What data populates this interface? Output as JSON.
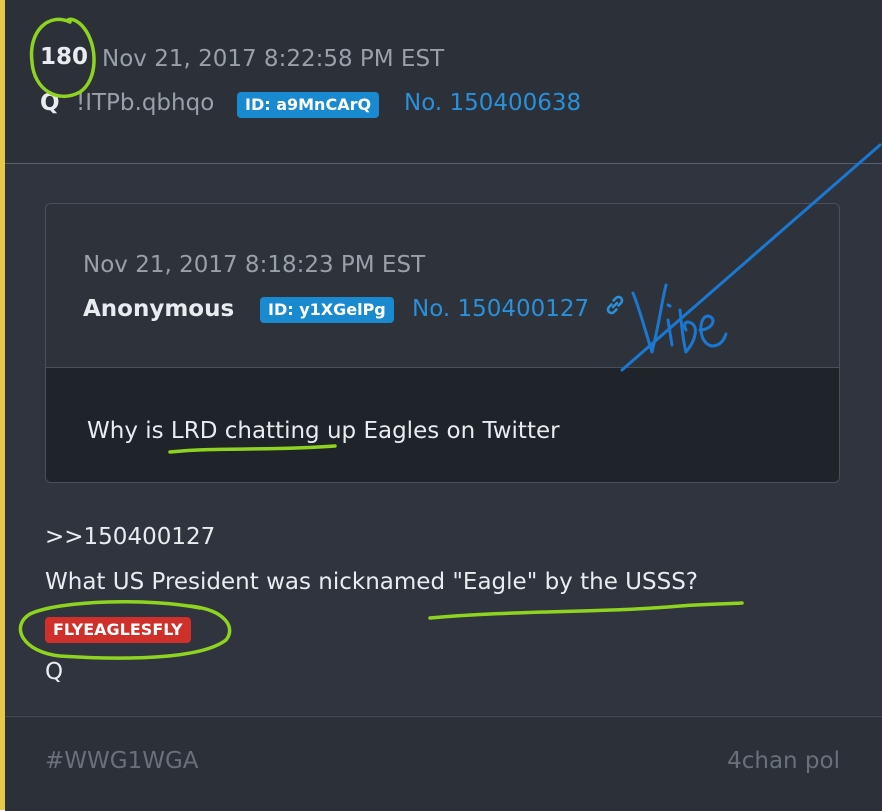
{
  "post": {
    "number": "180",
    "date": "Nov 21, 2017 8:22:58 PM EST",
    "author": "Q",
    "tripcode": "!ITPb.qbhqo",
    "id_badge": "ID: a9MnCArQ",
    "post_no": "No. 150400638"
  },
  "quoted": {
    "date": "Nov 21, 2017 8:18:23 PM EST",
    "author": "Anonymous",
    "id_badge": "ID: y1XGelPg",
    "post_no": "No. 150400127",
    "text": "Why is LRD chatting up Eagles on Twitter"
  },
  "reply": {
    "link": ">>150400127",
    "message": "What US President was nicknamed \"Eagle\" by the USSS?",
    "flag_badge": "FLYEAGLESFLY",
    "signature": "Q"
  },
  "footer": {
    "hashtag": "#WWG1WGA",
    "source": "4chan pol"
  },
  "annotation": {
    "handwriting": "Vibe"
  },
  "colors": {
    "background": "#2b3039",
    "id_badge": "#1a8ad0",
    "flag_badge": "#d0302a",
    "link": "#2a90d8",
    "green_annotation": "#8fd321",
    "blue_annotation": "#1b78d0",
    "left_border": "#e6c84a"
  },
  "icons": [
    "link-icon"
  ]
}
